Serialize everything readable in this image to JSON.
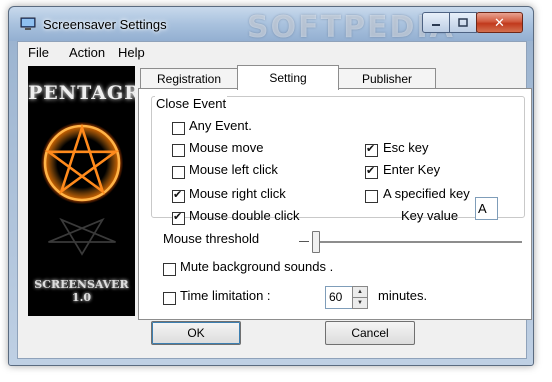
{
  "window": {
    "title": "Screensaver Settings",
    "watermark": "SOFTPEDIA",
    "controls": {
      "minimize": "–",
      "maximize": "□",
      "close": "✕"
    }
  },
  "menubar": {
    "items": [
      "File",
      "Action",
      "Help"
    ]
  },
  "logo": {
    "title": "PENTAGRAM",
    "subtitle_line1": "SCREENSAVER",
    "subtitle_line2": "1.0"
  },
  "tabs": [
    {
      "label": "Registration",
      "active": false
    },
    {
      "label": "Setting",
      "active": true
    },
    {
      "label": "Publisher",
      "active": false
    }
  ],
  "close_event": {
    "title": "Close Event",
    "left_options": [
      {
        "label": "Any Event.",
        "checked": false
      },
      {
        "label": "Mouse move",
        "checked": false
      },
      {
        "label": "Mouse left click",
        "checked": false
      },
      {
        "label": "Mouse right click",
        "checked": true
      },
      {
        "label": "Mouse double click",
        "checked": true
      }
    ],
    "right_options": [
      {
        "label": "Esc key",
        "checked": true
      },
      {
        "label": "Enter Key",
        "checked": true
      },
      {
        "label": "A specified key",
        "checked": false
      }
    ],
    "key_value_label": "Key value",
    "key_value": "A"
  },
  "mouse_threshold": {
    "label": "Mouse threshold",
    "value_fraction": 0.0
  },
  "mute": {
    "label": "Mute background sounds .",
    "checked": false
  },
  "time_limitation": {
    "label": "Time limitation :",
    "checked": false,
    "value": "60",
    "unit": "minutes."
  },
  "buttons": {
    "ok": "OK",
    "cancel": "Cancel"
  }
}
